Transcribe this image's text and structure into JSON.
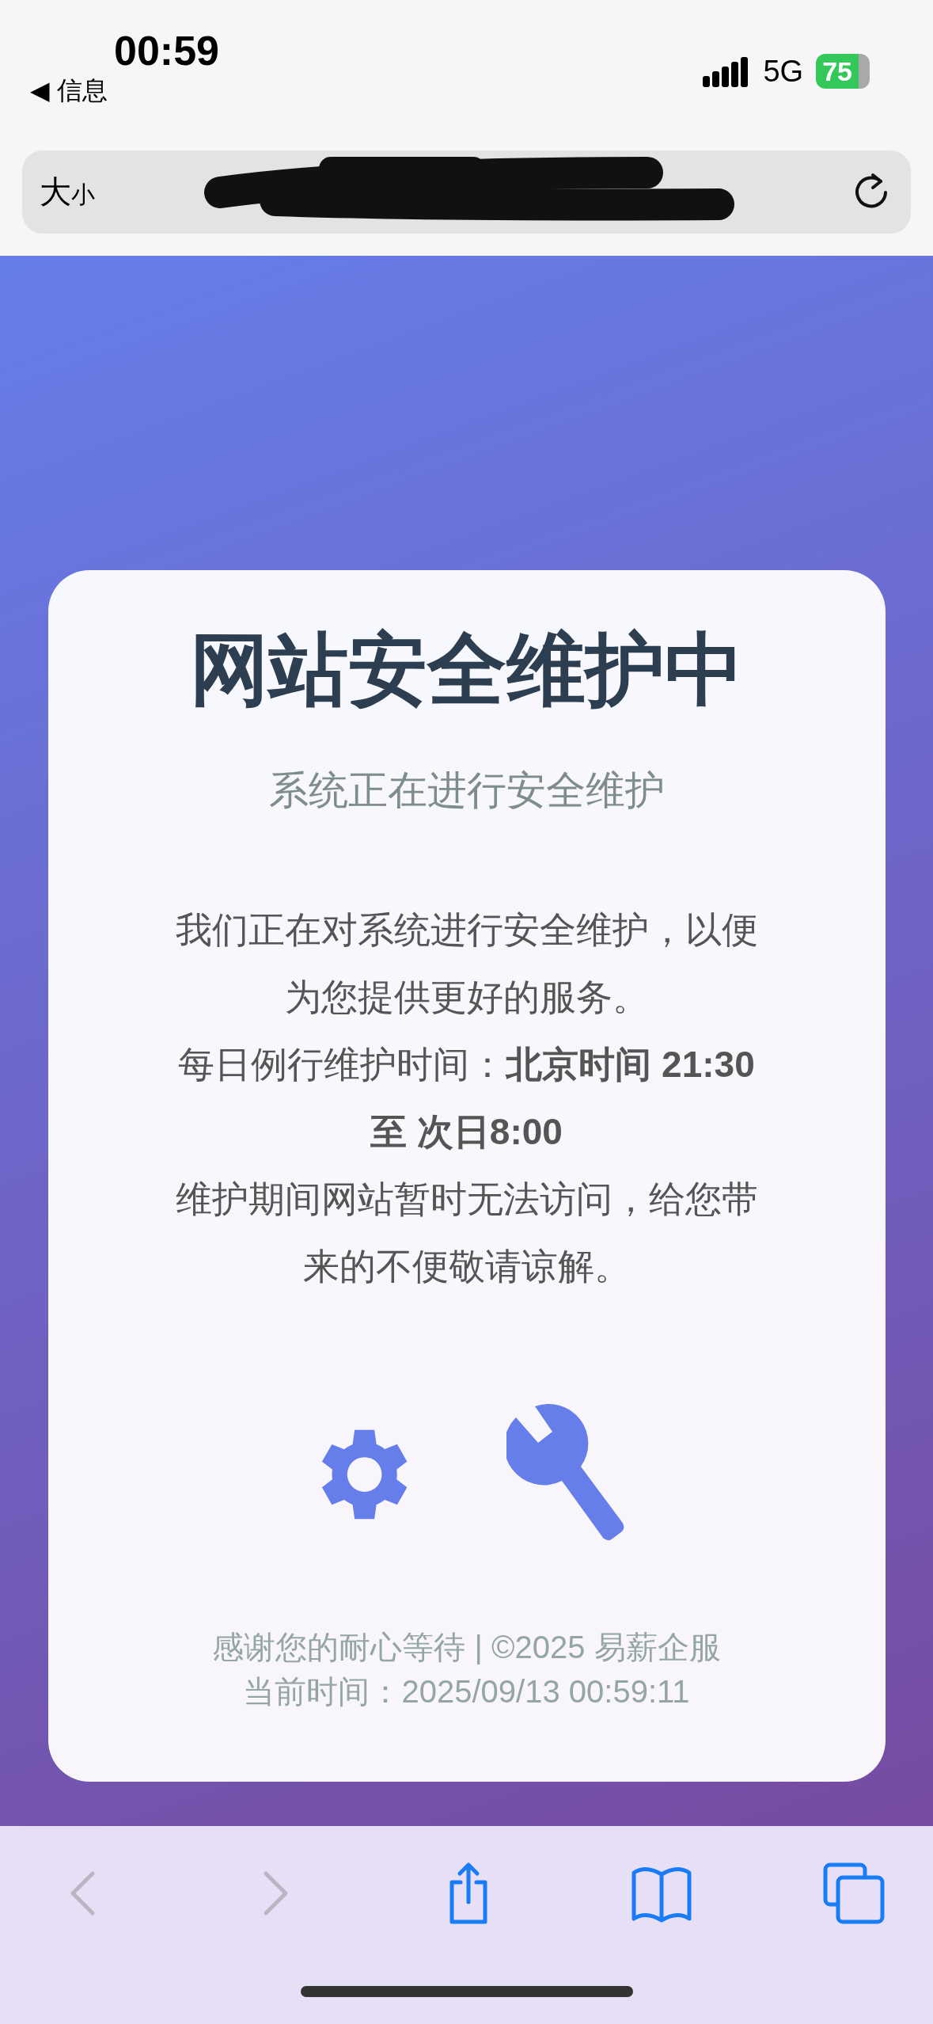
{
  "status_bar": {
    "time": "00:59",
    "back_link": "◀ 信息",
    "network": "5G",
    "battery": "75"
  },
  "address_bar": {
    "text_size": "大",
    "text_size_small": "小"
  },
  "card": {
    "title": "网站安全维护中",
    "subtitle": "系统正在进行安全维护",
    "paragraphs": [
      "我们正在对系统进行安全维护，以便为您提供更好的服务。",
      "每日例行维护时间：**北京时间 21:30 至 次日8:00**",
      "维护期间网站暂时无法访问，给您带来的不便敬请谅解。"
    ],
    "footer": [
      "感谢您的耐心等待 | ©2025 易薪企服",
      "当前时间：2025/09/13 00:59:11"
    ]
  },
  "toolbar": [
    {
      "kind": "back",
      "disabled": true
    },
    {
      "kind": "forward",
      "disabled": true
    },
    {
      "kind": "share",
      "disabled": false
    },
    {
      "kind": "bookmarks",
      "disabled": false
    },
    {
      "kind": "tabs",
      "disabled": false
    }
  ]
}
